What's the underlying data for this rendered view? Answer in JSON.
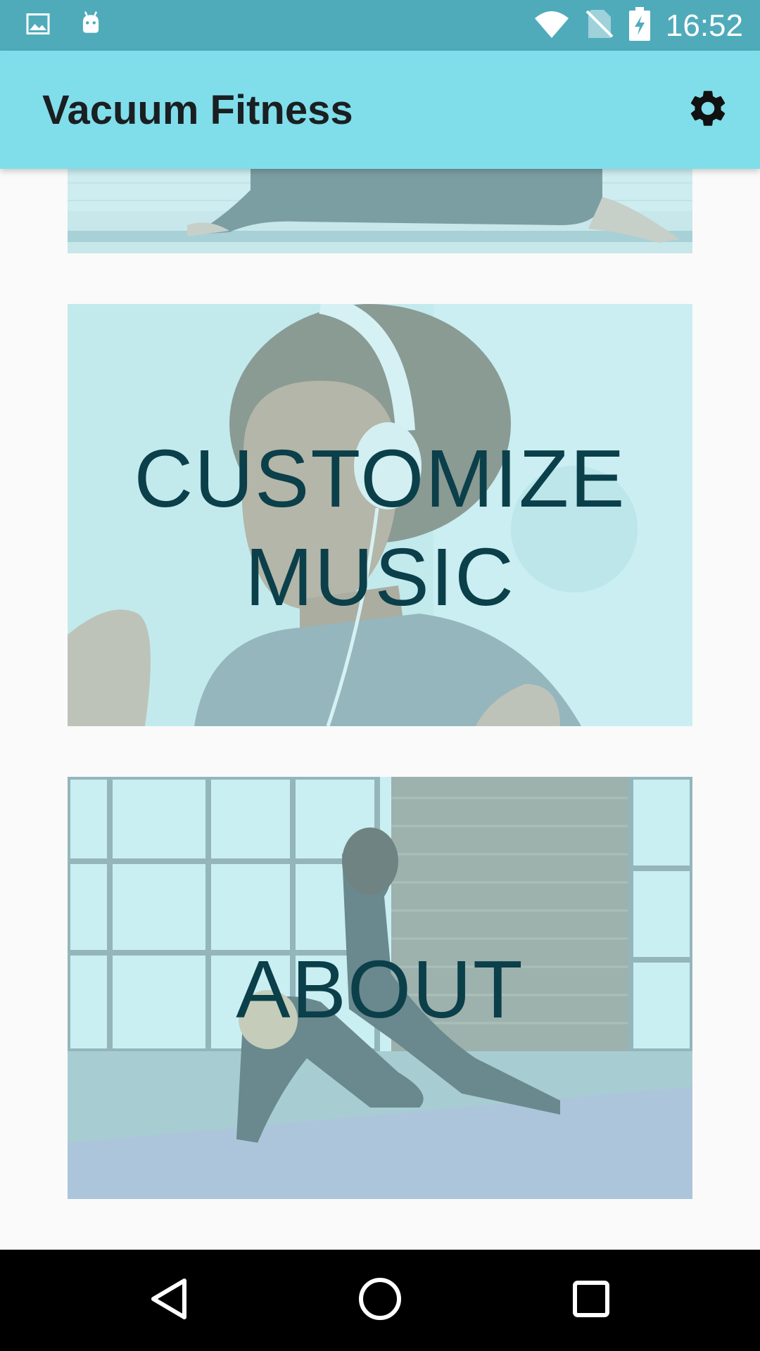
{
  "status_bar": {
    "time": "16:52",
    "left_icons": [
      "image-icon",
      "android-icon"
    ],
    "right_icons": [
      "wifi-icon",
      "no-sim-icon",
      "battery-charging-icon"
    ]
  },
  "app_bar": {
    "title": "Vacuum Fitness",
    "settings_icon": "gear-icon"
  },
  "cards": [
    {
      "label": ""
    },
    {
      "label_line1": "CUSTOMIZE",
      "label_line2": "MUSIC"
    },
    {
      "label": "ABOUT"
    }
  ],
  "nav_bar": {
    "icons": [
      "back-icon",
      "home-icon",
      "recents-icon"
    ]
  },
  "colors": {
    "status_bar": "#4fabba",
    "app_bar": "#80deea",
    "card_text": "#0b3f4a",
    "background": "#fafafa"
  }
}
